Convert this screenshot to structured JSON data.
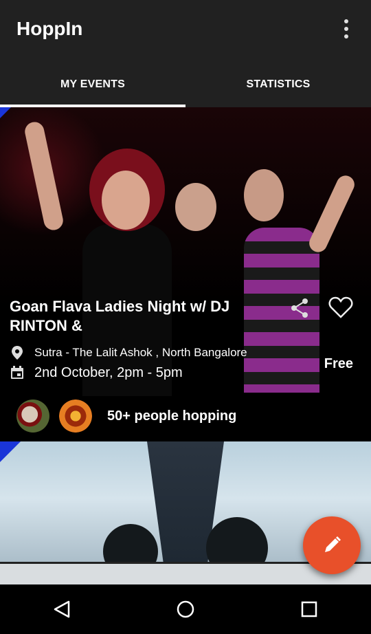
{
  "app": {
    "title": "HoppIn"
  },
  "tabs": [
    {
      "label": "MY EVENTS",
      "active": true
    },
    {
      "label": "STATISTICS",
      "active": false
    }
  ],
  "events": [
    {
      "title": "Goan Flava Ladies Night w/ DJ RINTON &",
      "venue": "Sutra - The Lalit Ashok , North Bangalore",
      "date": "2nd October, 2pm - 5pm",
      "price": "Free",
      "hoppers_text": "50+ people hopping"
    }
  ],
  "colors": {
    "appbar": "#212121",
    "fab": "#e8502a",
    "corner_flag": "#1a35d8"
  },
  "icons": [
    "overflow-menu-icon",
    "share-icon",
    "heart-icon",
    "location-pin-icon",
    "calendar-icon",
    "pencil-icon",
    "back-icon",
    "home-icon",
    "recents-icon"
  ]
}
